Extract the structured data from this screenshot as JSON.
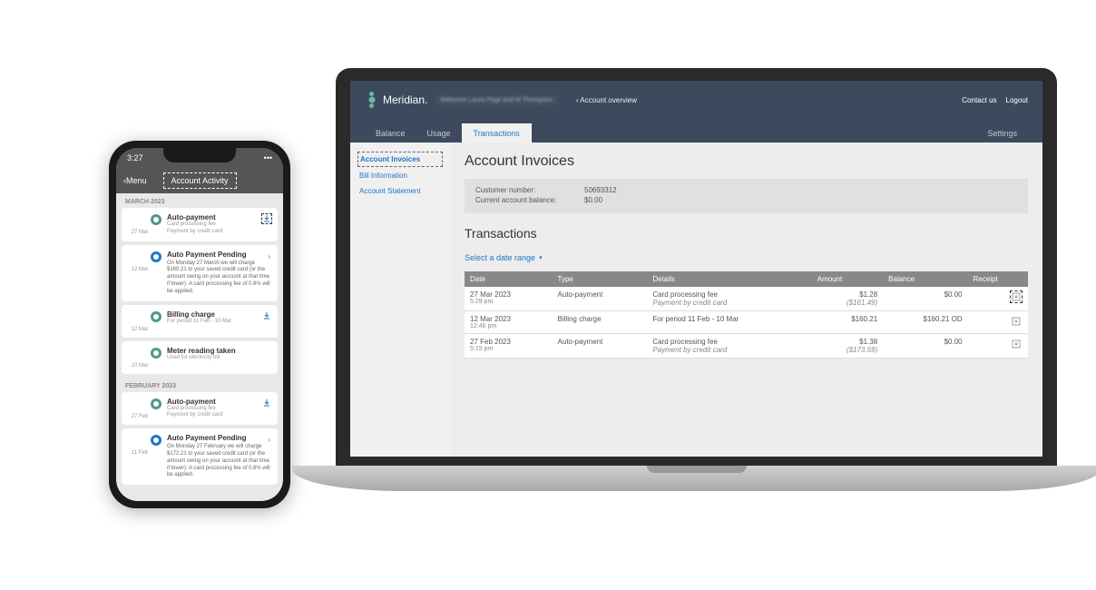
{
  "phone": {
    "time": "3:27",
    "menu_label": "Menu",
    "title": "Account Activity",
    "sections": [
      {
        "label": "MARCH 2023",
        "items": [
          {
            "date": "27 Mar",
            "icon": "person",
            "title": "Auto-payment",
            "subs": [
              "Card processing fee",
              "Payment by credit card"
            ],
            "download": true,
            "download_highlight": true
          },
          {
            "date": "12 Mar",
            "icon": "clock",
            "title": "Auto Payment Pending",
            "arrow": true,
            "detail": "On Monday 27 March we will charge $160.21 to your saved credit card (or the amount owing on your account at that time if lower). A card processing fee of 0.8% will be applied."
          },
          {
            "date": "12 Mar",
            "icon": "person",
            "title": "Billing charge",
            "subs": [
              "For period 11 Feb - 10 Mar"
            ],
            "download": true
          },
          {
            "date": "10 Mar",
            "icon": "person",
            "title": "Meter reading taken",
            "subs": [
              "Used for electricity bill"
            ]
          }
        ]
      },
      {
        "label": "FEBRUARY 2023",
        "items": [
          {
            "date": "27 Feb",
            "icon": "person",
            "title": "Auto-payment",
            "subs": [
              "Card processing fee",
              "Payment by credit card"
            ],
            "download": true
          },
          {
            "date": "11 Feb",
            "icon": "clock",
            "title": "Auto Payment Pending",
            "arrow": true,
            "detail": "On Monday 27 February we will charge $172.21 to your saved credit card (or the amount owing on your account at that time if lower). A card processing fee of 0.8% will be applied."
          }
        ]
      }
    ]
  },
  "laptop": {
    "brand": "Meridian.",
    "welcome": "Welcome Laura Page and M Thompson",
    "account_overview": "Account overview",
    "header_links": {
      "contact": "Contact us",
      "logout": "Logout"
    },
    "tabs": [
      {
        "label": "Balance"
      },
      {
        "label": "Usage"
      },
      {
        "label": "Transactions",
        "active": true
      },
      {
        "label": "Settings",
        "right": true
      }
    ],
    "sidebar": [
      {
        "label": "Account Invoices",
        "active": true
      },
      {
        "label": "Bill Information"
      },
      {
        "label": "Account Statement"
      }
    ],
    "page_title": "Account Invoices",
    "customer_number_label": "Customer number:",
    "customer_number": "50693312",
    "balance_label": "Current account balance:",
    "balance_value": "$0.00",
    "transactions_heading": "Transactions",
    "date_range_label": "Select a date range",
    "table": {
      "headers": [
        "Date",
        "Type",
        "Details",
        "Amount",
        "Balance",
        "Receipt"
      ],
      "rows": [
        {
          "date": "27 Mar 2023",
          "time": "5:29 pm",
          "type": "Auto-payment",
          "detail1": "Card processing fee",
          "detail2": "Payment by credit card",
          "amount1": "$1.28",
          "amount2": "($161.49)",
          "balance": "$0.00",
          "receipt": true,
          "receipt_highlight": true
        },
        {
          "date": "12 Mar 2023",
          "time": "12:46 pm",
          "type": "Billing charge",
          "detail1": "For period 11 Feb - 10 Mar",
          "amount1": "$160.21",
          "balance": "$160.21 OD",
          "balance_neg": true,
          "receipt": true
        },
        {
          "date": "27 Feb 2023",
          "time": "5:15 pm",
          "type": "Auto-payment",
          "detail1": "Card processing fee",
          "detail2": "Payment by credit card",
          "amount1": "$1.38",
          "amount2": "($173.59)",
          "balance": "$0.00",
          "receipt": true
        }
      ]
    }
  }
}
